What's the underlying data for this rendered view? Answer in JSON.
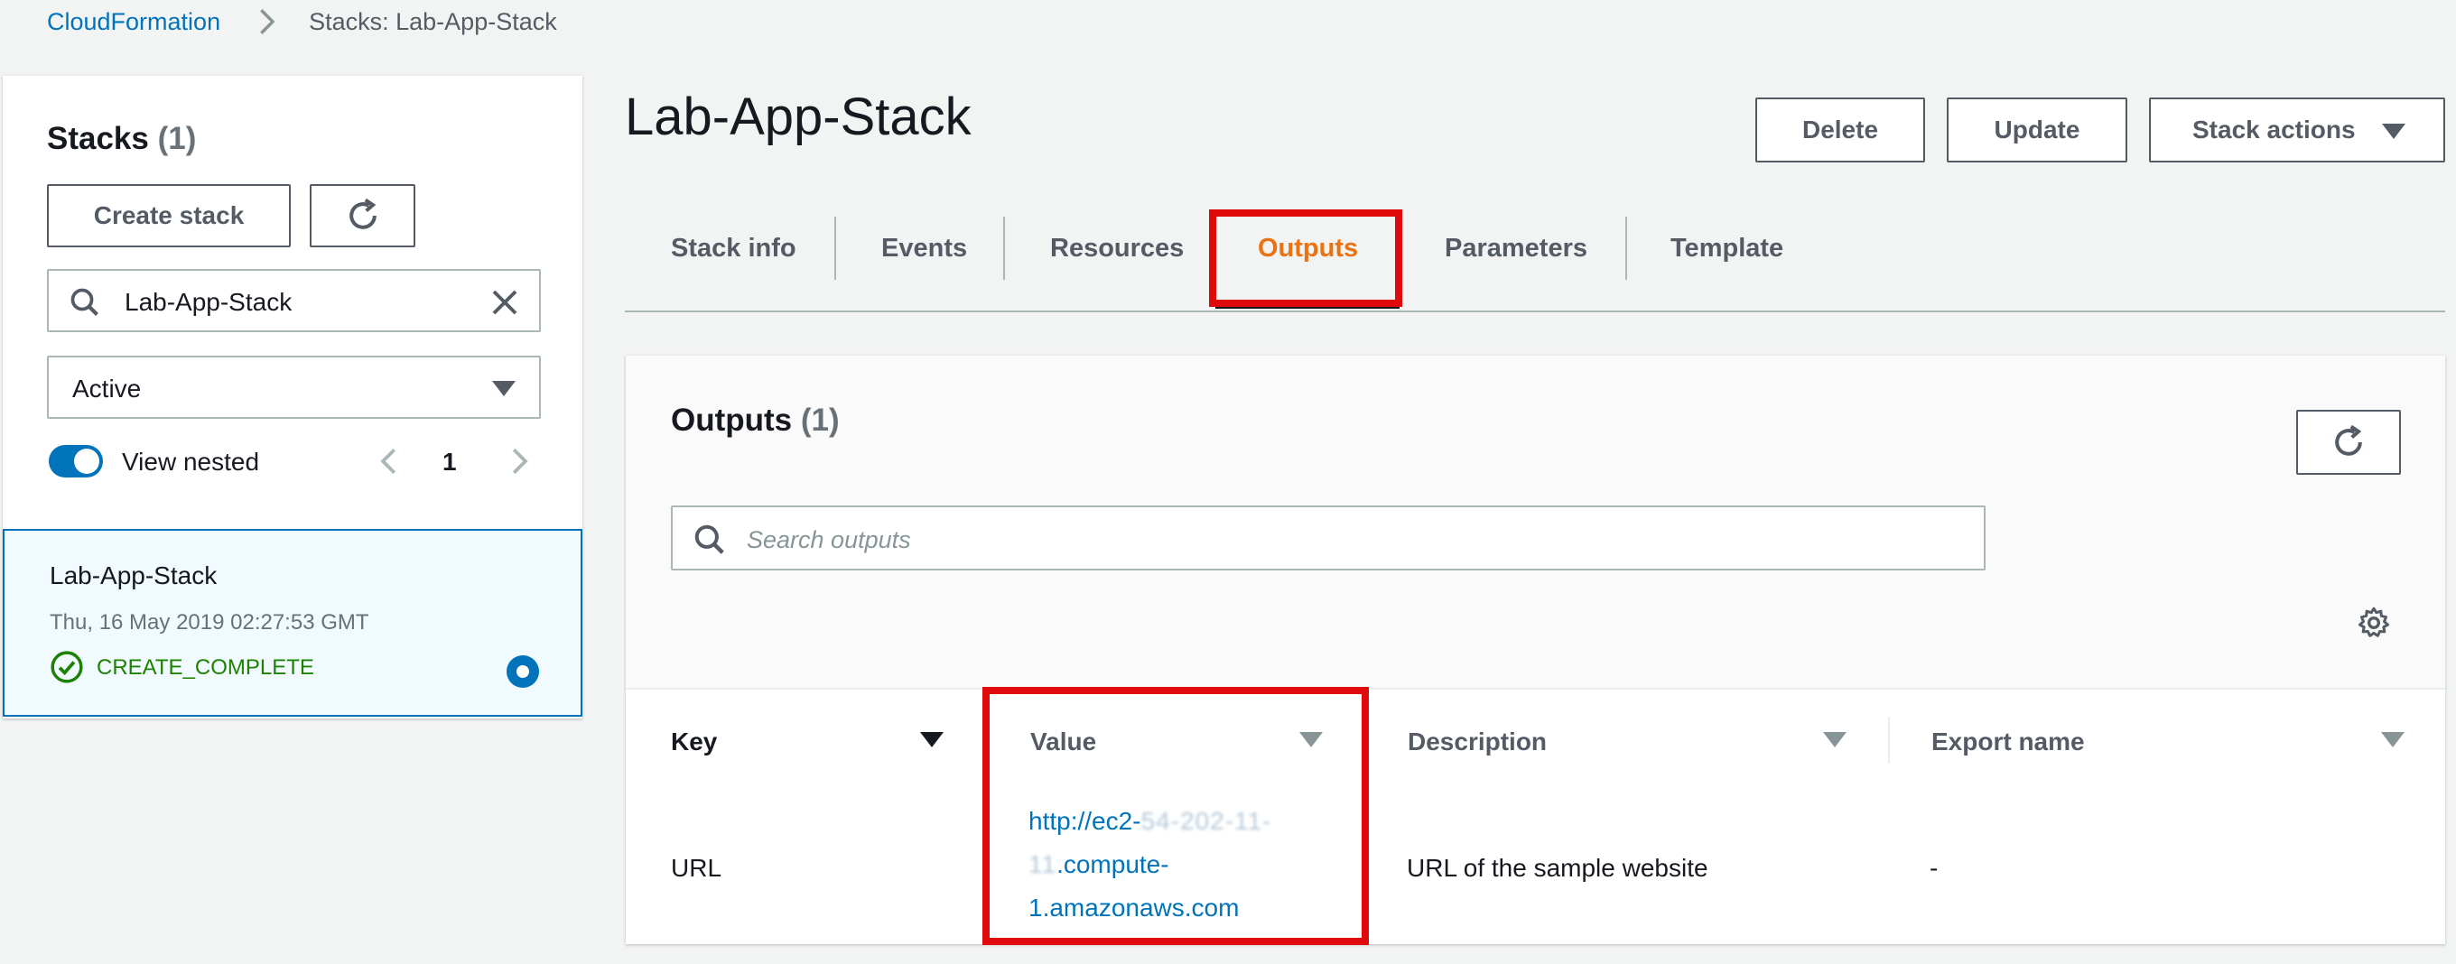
{
  "breadcrumb": {
    "root": "CloudFormation",
    "current": "Stacks: Lab-App-Stack"
  },
  "sidebar": {
    "title": "Stacks",
    "count": "(1)",
    "create_label": "Create stack",
    "search_value": "Lab-App-Stack",
    "filter_value": "Active",
    "view_nested_label": "View nested",
    "view_nested_on": true,
    "page": "1",
    "stack": {
      "name": "Lab-App-Stack",
      "date": "Thu, 16 May 2019 02:27:53 GMT",
      "status": "CREATE_COMPLETE"
    }
  },
  "main": {
    "title": "Lab-App-Stack",
    "buttons": {
      "delete": "Delete",
      "update": "Update",
      "stack_actions": "Stack actions"
    },
    "tabs": [
      "Stack info",
      "Events",
      "Resources",
      "Outputs",
      "Parameters",
      "Template"
    ],
    "active_tab": "Outputs"
  },
  "outputs": {
    "title": "Outputs",
    "count": "(1)",
    "search_placeholder": "Search outputs",
    "columns": {
      "key": "Key",
      "value": "Value",
      "description": "Description",
      "export": "Export name"
    },
    "row": {
      "key": "URL",
      "value_line1_prefix": "http://ec2-",
      "value_line1_redacted": "54-202-11-",
      "value_line2_redacted": "11",
      "value_line2_suffix": ".compute-",
      "value_line3": "1.amazonaws.com",
      "description": "URL of the sample website",
      "export": "-"
    }
  },
  "colors": {
    "link": "#0073bb",
    "active_tab": "#ec7211",
    "highlight": "#e0090b",
    "success": "#1d8102"
  }
}
